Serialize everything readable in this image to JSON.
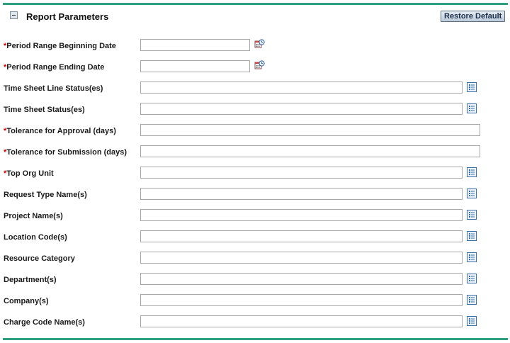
{
  "header": {
    "title": "Report Parameters",
    "restore_label": "Restore Default"
  },
  "required_marker": "*",
  "fields": [
    {
      "label": "Period Range Beginning Date",
      "required": true,
      "kind": "date",
      "value": ""
    },
    {
      "label": "Period Range Ending Date",
      "required": true,
      "kind": "date",
      "value": ""
    },
    {
      "label": "Time Sheet Line Status(es)",
      "required": false,
      "kind": "list",
      "value": ""
    },
    {
      "label": "Time Sheet Status(es)",
      "required": false,
      "kind": "list",
      "value": ""
    },
    {
      "label": "Tolerance for Approval (days)",
      "required": true,
      "kind": "text",
      "value": ""
    },
    {
      "label": "Tolerance for Submission (days)",
      "required": true,
      "kind": "text",
      "value": ""
    },
    {
      "label": "Top Org Unit",
      "required": true,
      "kind": "list",
      "value": ""
    },
    {
      "label": "Request Type Name(s)",
      "required": false,
      "kind": "list",
      "value": ""
    },
    {
      "label": "Project Name(s)",
      "required": false,
      "kind": "list",
      "value": ""
    },
    {
      "label": "Location Code(s)",
      "required": false,
      "kind": "list",
      "value": ""
    },
    {
      "label": "Resource Category",
      "required": false,
      "kind": "list",
      "value": ""
    },
    {
      "label": "Department(s)",
      "required": false,
      "kind": "list",
      "value": ""
    },
    {
      "label": "Company(s)",
      "required": false,
      "kind": "list",
      "value": ""
    },
    {
      "label": "Charge Code Name(s)",
      "required": false,
      "kind": "list",
      "value": ""
    }
  ],
  "icons": {
    "date": "calendar-icon",
    "list": "list-picker-icon",
    "collapse": "collapse-icon"
  },
  "colors": {
    "accent_rule": "#2e9e7e",
    "required": "#cc0000",
    "button_text": "#1a2c45"
  }
}
